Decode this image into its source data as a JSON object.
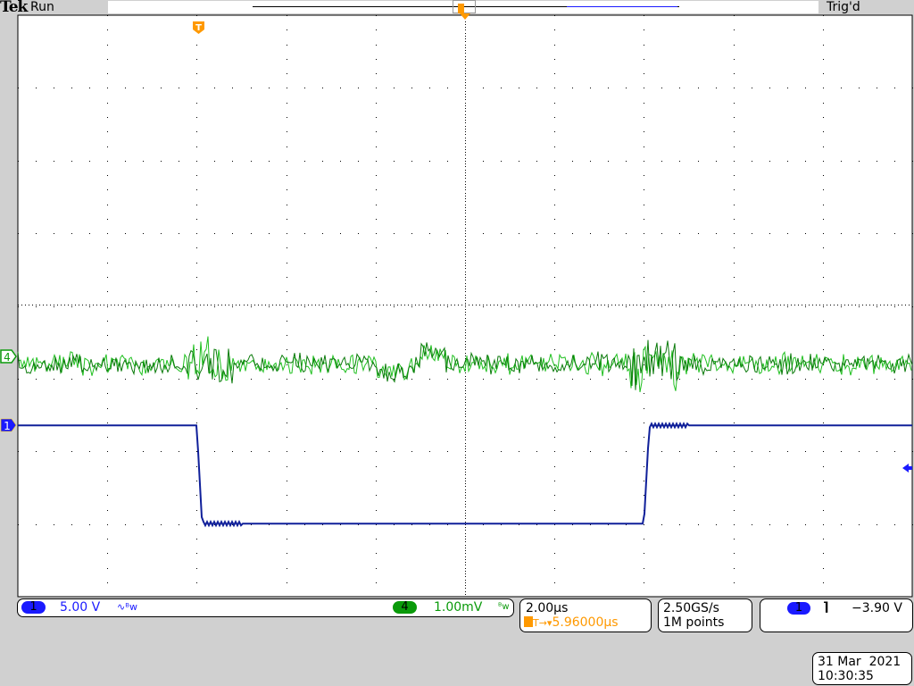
{
  "header": {
    "brand": "Tek",
    "status": "Run",
    "trigger_state": "Trig'd"
  },
  "channels": [
    {
      "number": "1",
      "scale": "5.00 V",
      "bw_icon": "∿ᴮw",
      "color": "#1a1aff"
    },
    {
      "number": "4",
      "scale": "1.00mV",
      "bw_icon": "ᴮw",
      "color": "#0a9a0a"
    }
  ],
  "timebase": {
    "scale": "2.00µs",
    "trigger_position": "5.96000µs",
    "trigger_prefix": "T→▾"
  },
  "acquisition": {
    "sample_rate": "2.50GS/s",
    "record_length": "1M points"
  },
  "trigger": {
    "source": "1",
    "slope_icon": "falling-edge",
    "slope_glyph": "⌉",
    "level": "−3.90 V"
  },
  "datetime": {
    "date": "31 Mar  2021",
    "time": "10:30:35"
  },
  "markers": {
    "trigger_marker": "T",
    "ch4_marker": "4",
    "ch1_marker": "1"
  },
  "colors": {
    "ch1": "#1a1aff",
    "ch1_trace": "#10209a",
    "ch4": "#0a9a0a",
    "ch4_trace": "#20c020",
    "trigger": "#ff9900"
  },
  "waveforms": {
    "ch1": {
      "high_div": -1.65,
      "low_div": -3.0,
      "fall_time_div": -3.0,
      "rise_time_div": 2.0
    },
    "ch4": {
      "offset_div": -0.8
    }
  }
}
